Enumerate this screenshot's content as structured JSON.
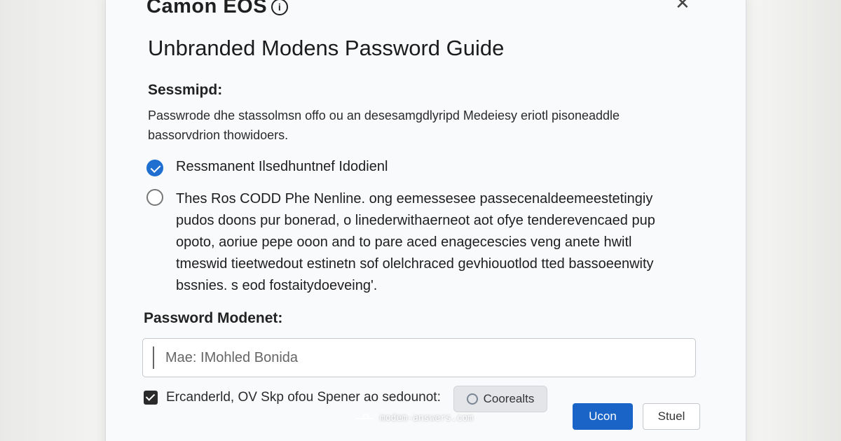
{
  "header": {
    "brand": "Camon EOS",
    "brand_icon": "info-icon",
    "close_glyph": "✕"
  },
  "dialog": {
    "title": "Unbranded Modens Password Guide",
    "section_label": "Sessmipd:",
    "description": "Passwrode dhe stassolmsn offo ou an desesamgdlyripd Medeiesy eriotl pisoneaddle bassorvdrion thowidoers."
  },
  "options": [
    {
      "label": "Ressmanent Ilsedhuntnef Idodienl",
      "checked": true
    },
    {
      "label": "Thes Ros CODD Phe Nenline. ong eemessesee passecenaldeemeestetingiy pudos doons pur bonerad, o linederwithaerneot aot ofye tenderevencaed pup opoto, aoriue pepe ooon and to pare aced enagecescies veng anete hwitl tmeswid tieetwedout estinetn sof olelchraced gevhiouotlod tted bassoeenwity bssnies. s eod fostaitydoeveing'.",
      "checked": false
    }
  ],
  "password_field": {
    "label": "Password Modenet:",
    "placeholder": "Mae: IMohled Bonida"
  },
  "footer": {
    "checkbox_label": "Ercanderld, OV Skp ofou Spener ao sedounot:",
    "checkbox_checked": true,
    "secondary_pill": "Coorealts",
    "secondary_pill_icon": "gear-icon",
    "primary_button": "Ucon",
    "cancel_button": "Stuel"
  },
  "watermark": {
    "text": "modem-answers.com",
    "icon": "modem-icon"
  },
  "colors": {
    "accent": "#1a64c8",
    "radio_checked": "#1f6fd1",
    "card_bg": "#f9fafb"
  }
}
